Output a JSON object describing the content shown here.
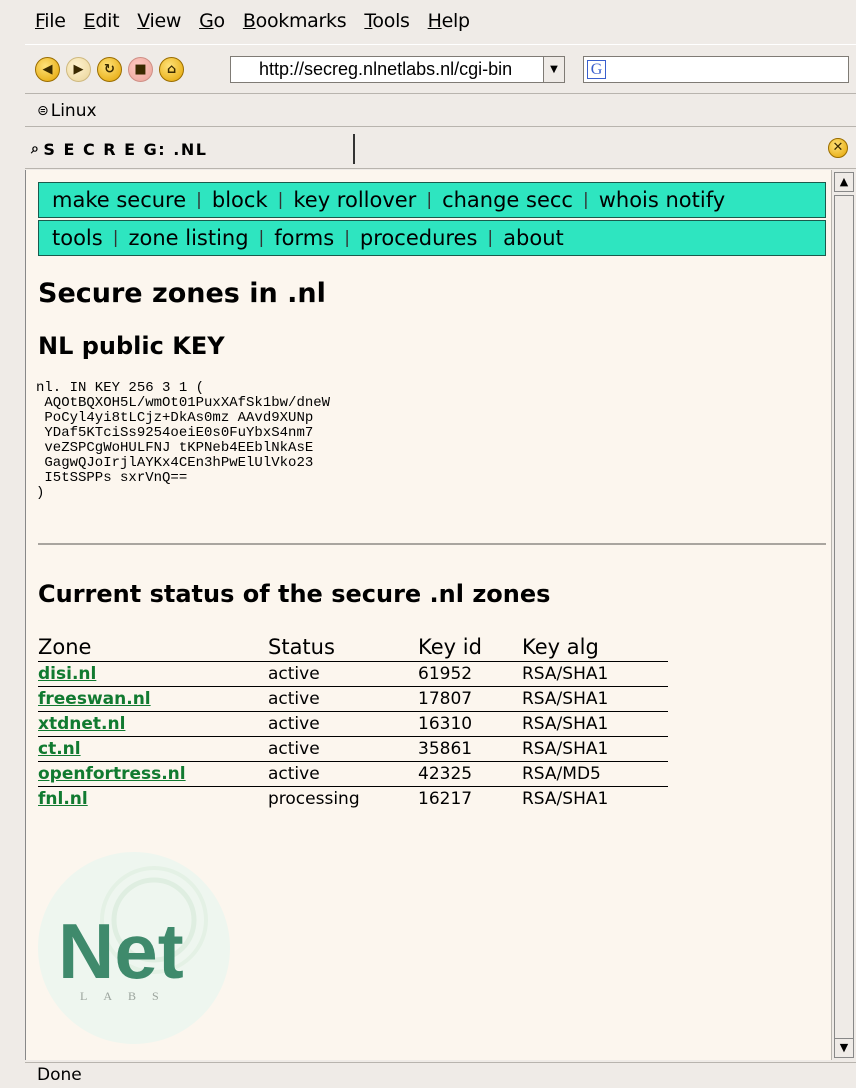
{
  "menu": [
    "File",
    "Edit",
    "View",
    "Go",
    "Bookmarks",
    "Tools",
    "Help"
  ],
  "menu_underline": [
    "F",
    "E",
    "V",
    "G",
    "B",
    "T",
    "H"
  ],
  "url": "http://secreg.nlnetlabs.nl/cgi-bin",
  "search_engine_icon": "G",
  "bookmark": "Linux",
  "tab_title": "S E C R E G: .NL",
  "nav": {
    "row1": [
      "make secure",
      "block",
      "key rollover",
      "change secc",
      "whois notify"
    ],
    "row2": [
      "tools",
      "zone listing",
      "forms",
      "procedures",
      "about"
    ],
    "separator": "|"
  },
  "page": {
    "title": "Secure zones in .nl",
    "key_heading": "NL public KEY",
    "key_text": "nl. IN KEY 256 3 1 (\n AQOtBQXOH5L/wmOt01PuxXAfSk1bw/dneW\n PoCyl4yi8tLCjz+DkAs0mz AAvd9XUNp\n YDaf5KTciSs9254oeiE0s0FuYbxS4nm7\n veZSPCgWoHULFNJ tKPNeb4EEblNkAsE\n GagwQJoIrjlAYKx4CEn3hPwElUlVko23\n I5tSSPPs sxrVnQ==\n)",
    "status_heading": "Current status of the secure .nl zones",
    "table": {
      "headers": [
        "Zone",
        "Status",
        "Key id",
        "Key alg"
      ],
      "rows": [
        [
          "disi.nl",
          "active",
          "61952",
          "RSA/SHA1"
        ],
        [
          "freeswan.nl",
          "active",
          "17807",
          "RSA/SHA1"
        ],
        [
          "xtdnet.nl",
          "active",
          "16310",
          "RSA/SHA1"
        ],
        [
          "ct.nl",
          "active",
          "35861",
          "RSA/SHA1"
        ],
        [
          "openfortress.nl",
          "active",
          "42325",
          "RSA/MD5"
        ],
        [
          "fnl.nl",
          "processing",
          "16217",
          "RSA/SHA1"
        ]
      ]
    },
    "logo": {
      "main": "Net",
      "sub": "LABS"
    }
  },
  "status_bar": "Done",
  "colors": {
    "nav_bg": "#2ee5c0",
    "zone_link": "#117a30",
    "page_bg": "#fcf6ee",
    "chrome_bg": "#efebe7"
  }
}
